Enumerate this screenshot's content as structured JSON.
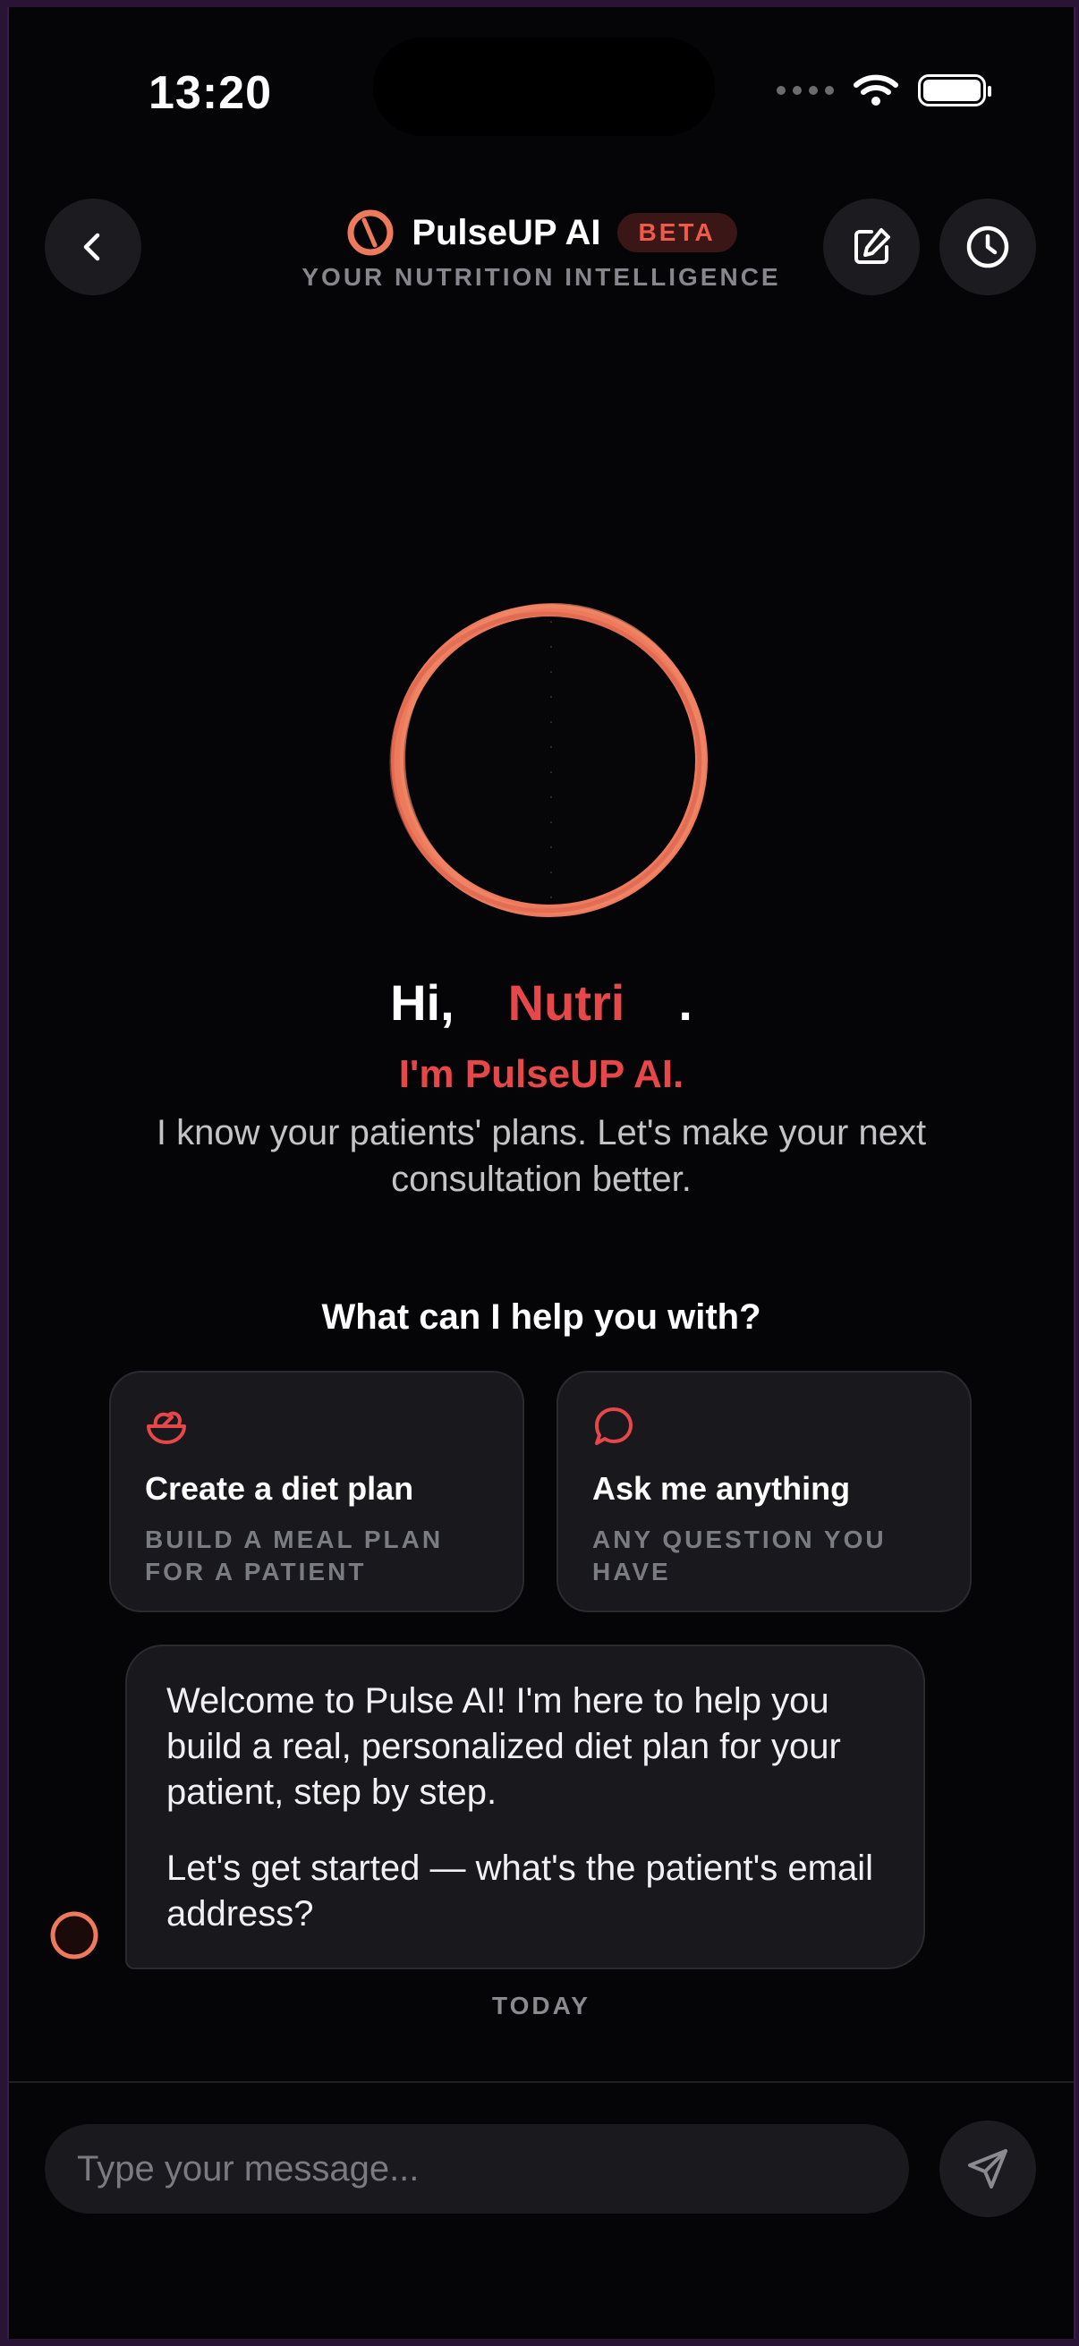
{
  "status_bar": {
    "time": "13:20"
  },
  "header": {
    "title": "PulseUP AI",
    "badge": "BETA",
    "tagline": "YOUR NUTRITION INTELLIGENCE"
  },
  "greeting": {
    "hi": "Hi,",
    "name": "Nutri",
    "punct": ".",
    "intro": "I'm PulseUP AI.",
    "description": "I know your patients' plans. Let's make your next consultation better."
  },
  "help": {
    "title": "What can I help you with?",
    "cards": [
      {
        "title": "Create a diet plan",
        "subtitle": "BUILD A MEAL PLAN FOR A PATIENT",
        "icon": "salad-bowl-icon"
      },
      {
        "title": "Ask me anything",
        "subtitle": "ANY QUESTION YOU HAVE",
        "icon": "chat-bubble-icon"
      }
    ]
  },
  "message": {
    "paragraph1": "Welcome to Pulse AI! I'm here to help you build a real, personalized diet plan for your patient, step by step.",
    "paragraph2": "Let's get started — what's the patient's email address?",
    "date_label": "TODAY"
  },
  "composer": {
    "placeholder": "Type your message..."
  },
  "colors": {
    "accent": "#e8474a",
    "orb": "#ee7a5c",
    "background": "#050507",
    "card": "#18181d"
  }
}
